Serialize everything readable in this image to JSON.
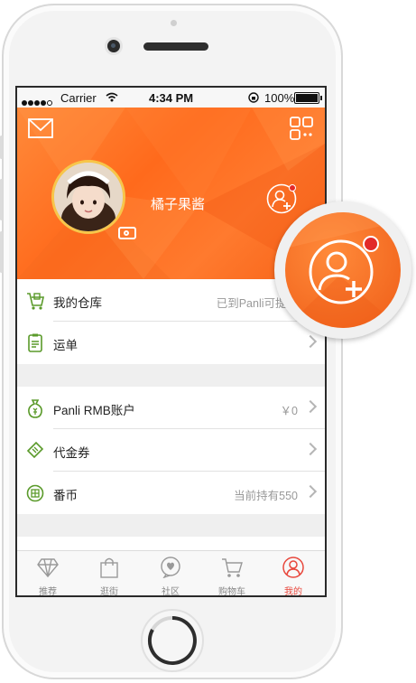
{
  "status_bar": {
    "carrier": "Carrier",
    "time": "4:34 PM",
    "battery": "100%"
  },
  "header": {
    "username": "橘子果酱",
    "accent": "#ff6a1c",
    "icons": [
      "mail-icon",
      "grid-menu-icon",
      "add-friend-icon",
      "camera-icon"
    ]
  },
  "section1": {
    "items": [
      {
        "label": "我的仓库",
        "value": "已到Panli可提交",
        "icon": "warehouse-icon"
      },
      {
        "label": "运单",
        "value": "",
        "icon": "waybill-icon"
      }
    ]
  },
  "section2": {
    "items": [
      {
        "label": "Panli RMB账户",
        "value": "￥0",
        "icon": "money-bag-icon"
      },
      {
        "label": "代金券",
        "value": "",
        "icon": "coupon-icon"
      },
      {
        "label": "番币",
        "value": "当前持有550",
        "icon": "coin-icon"
      }
    ]
  },
  "tabbar": {
    "items": [
      {
        "label": "推荐",
        "icon": "diamond-icon"
      },
      {
        "label": "逛街",
        "icon": "shopping-bag-icon"
      },
      {
        "label": "社区",
        "icon": "chat-bubble-icon"
      },
      {
        "label": "购物车",
        "icon": "cart-icon"
      },
      {
        "label": "我的",
        "icon": "user-icon"
      }
    ],
    "active_color": "#e8473c"
  }
}
